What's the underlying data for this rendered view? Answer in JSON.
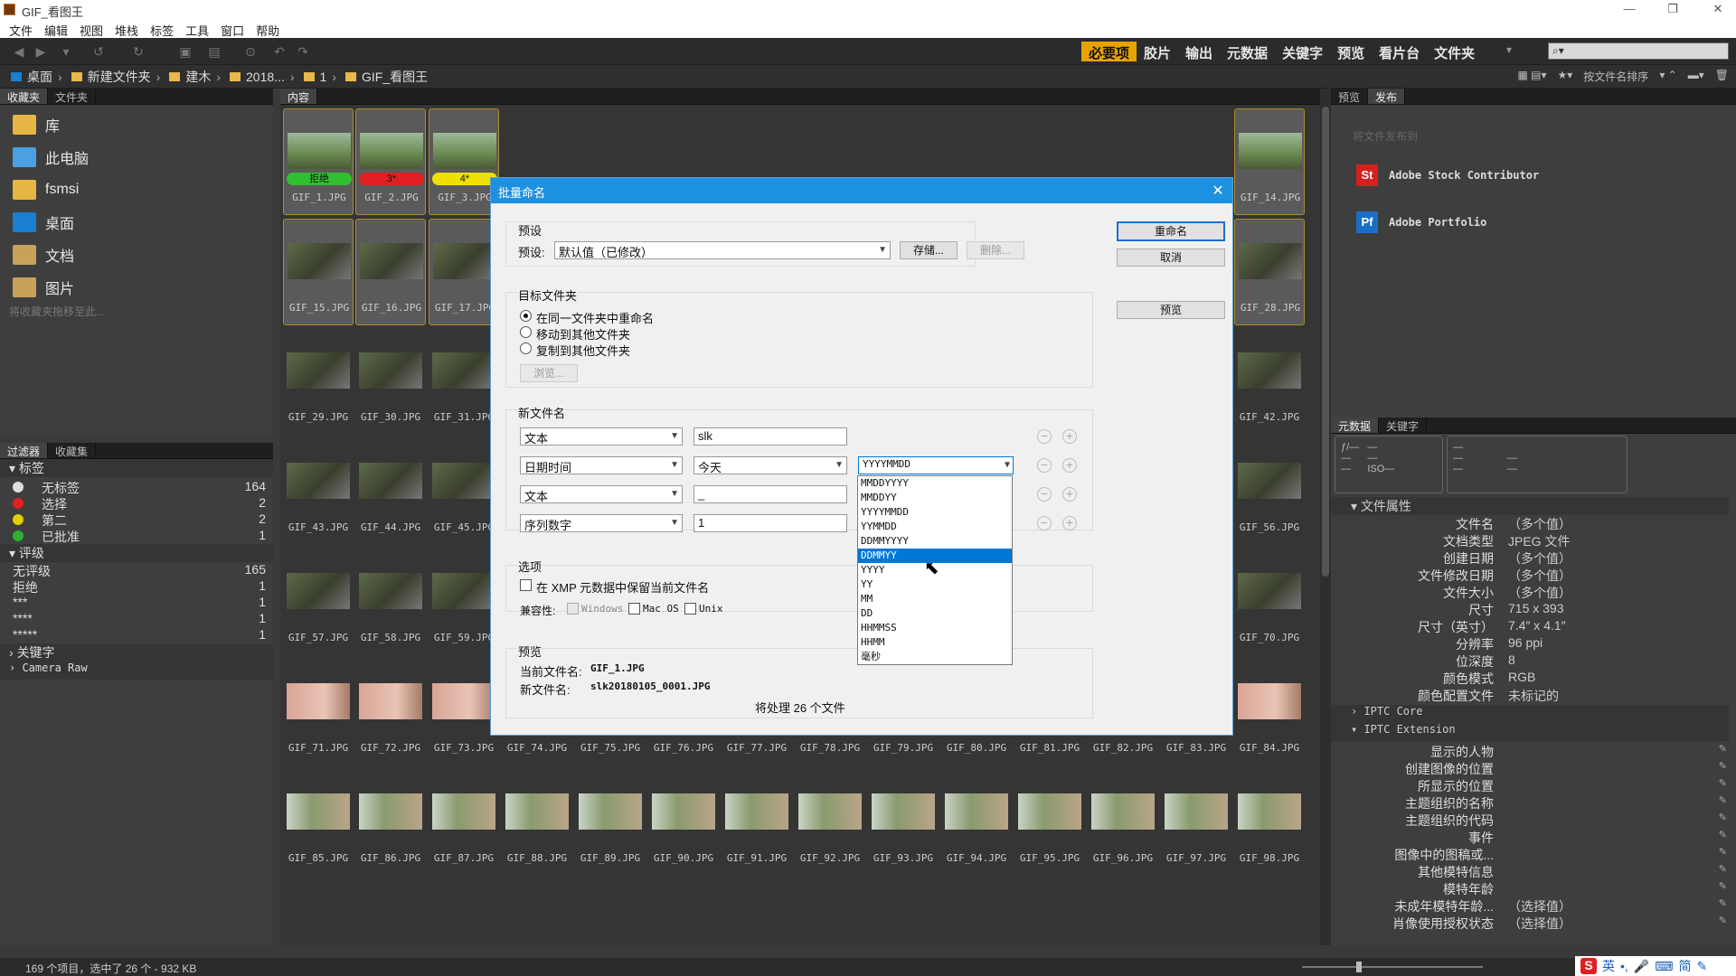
{
  "window": {
    "title": "GIF_看图王"
  },
  "menu": [
    "文件",
    "编辑",
    "视图",
    "堆栈",
    "标签",
    "工具",
    "窗口",
    "帮助"
  ],
  "workspaces": [
    "必要项",
    "胶片",
    "输出",
    "元数据",
    "关键字",
    "预览",
    "看片台",
    "文件夹"
  ],
  "path": [
    "桌面",
    "新建文件夹",
    "建木",
    "2018...",
    "1",
    "GIF_看图王"
  ],
  "sort_label": "按文件名排序",
  "fav_tabs": [
    "收藏夹",
    "文件夹"
  ],
  "fav_items": [
    "库",
    "此电脑",
    "fsmsi",
    "桌面",
    "文档",
    "图片"
  ],
  "fav_hint": "将收藏夹拖移至此...",
  "filter_tabs": [
    "过滤器",
    "收藏集"
  ],
  "filter": {
    "labels_hdr": "标签",
    "labels": [
      {
        "name": "无标签",
        "count": "164",
        "color": "#dddddd"
      },
      {
        "name": "选择",
        "count": "2",
        "color": "#e02020"
      },
      {
        "name": "第二",
        "count": "2",
        "color": "#e0d000"
      },
      {
        "name": "已批准",
        "count": "1",
        "color": "#30b030"
      }
    ],
    "rating_hdr": "评级",
    "ratings": [
      {
        "name": "无评级",
        "count": "165"
      },
      {
        "name": "拒绝",
        "count": "1"
      },
      {
        "name": "***",
        "count": "1"
      },
      {
        "name": "****",
        "count": "1"
      },
      {
        "name": "*****",
        "count": "1"
      }
    ],
    "keywords_hdr": "关键字",
    "camera_hdr": "Camera Raw"
  },
  "content_tab": "内容",
  "files": {
    "row1": [
      "GIF_1.JPG",
      "GIF_2.JPG",
      "GIF_3.JPG",
      "GIF_14.JPG"
    ],
    "row2": [
      "GIF_15.JPG",
      "GIF_16.JPG",
      "GIF_17.JPG",
      "GIF_28.JPG"
    ],
    "row3": [
      "GIF_29.JPG",
      "GIF_30.JPG",
      "GIF_31.JPG",
      "GIF_42.JPG"
    ],
    "row4": [
      "GIF_43.JPG",
      "GIF_44.JPG",
      "GIF_45.JPG",
      "GIF_56.JPG"
    ],
    "row5": [
      "GIF_57.JPG",
      "GIF_58.JPG",
      "GIF_59.JPG",
      "GIF_70.JPG"
    ],
    "row6": [
      "GIF_71.JPG",
      "GIF_72.JPG",
      "GIF_73.JPG",
      "GIF_74.JPG",
      "GIF_75.JPG",
      "GIF_76.JPG",
      "GIF_77.JPG",
      "GIF_78.JPG",
      "GIF_79.JPG",
      "GIF_80.JPG",
      "GIF_81.JPG",
      "GIF_82.JPG",
      "GIF_83.JPG",
      "GIF_84.JPG"
    ],
    "row7": [
      "GIF_85.JPG",
      "GIF_86.JPG",
      "GIF_87.JPG",
      "GIF_88.JPG",
      "GIF_89.JPG",
      "GIF_90.JPG",
      "GIF_91.JPG",
      "GIF_92.JPG",
      "GIF_93.JPG",
      "GIF_94.JPG",
      "GIF_95.JPG",
      "GIF_96.JPG",
      "GIF_97.JPG",
      "GIF_98.JPG"
    ]
  },
  "cell_labels": [
    {
      "text": "拒绝",
      "color": "#30c030"
    },
    {
      "text": "3*",
      "color": "#e02020"
    },
    {
      "text": "4*",
      "color": "#f0e000"
    }
  ],
  "right_tabs": [
    "预览",
    "发布"
  ],
  "publish_hint": "将文件发布到",
  "publish": [
    {
      "icon": "St",
      "name": "Adobe Stock Contributor",
      "color": "#d42020"
    },
    {
      "icon": "Pf",
      "name": "Adobe Portfolio",
      "color": "#1a6ec9"
    }
  ],
  "meta_tabs": [
    "元数据",
    "关键字"
  ],
  "meta_section": "文件属性",
  "meta": [
    {
      "k": "文件名",
      "v": "（多个值）"
    },
    {
      "k": "文档类型",
      "v": "JPEG 文件"
    },
    {
      "k": "创建日期",
      "v": "（多个值）"
    },
    {
      "k": "文件修改日期",
      "v": "（多个值）"
    },
    {
      "k": "文件大小",
      "v": "（多个值）"
    },
    {
      "k": "尺寸",
      "v": "715 x 393"
    },
    {
      "k": "尺寸（英寸）",
      "v": "7.4″ x 4.1″"
    },
    {
      "k": "分辨率",
      "v": "96 ppi"
    },
    {
      "k": "位深度",
      "v": "8"
    },
    {
      "k": "颜色模式",
      "v": "RGB"
    },
    {
      "k": "颜色配置文件",
      "v": "未标记的"
    }
  ],
  "iptc_core": "IPTC Core",
  "iptc_ext": "IPTC Extension",
  "iptc_rows": [
    {
      "k": "显示的人物",
      "v": ""
    },
    {
      "k": "创建图像的位置",
      "v": ""
    },
    {
      "k": "所显示的位置",
      "v": ""
    },
    {
      "k": "主题组织的名称",
      "v": ""
    },
    {
      "k": "主题组织的代码",
      "v": ""
    },
    {
      "k": "事件",
      "v": ""
    },
    {
      "k": "图像中的图稿或...",
      "v": ""
    },
    {
      "k": "其他模特信息",
      "v": ""
    },
    {
      "k": "模特年龄",
      "v": ""
    },
    {
      "k": "未成年模特年龄...",
      "v": "（选择值）"
    },
    {
      "k": "肖像使用授权状态",
      "v": "（选择值）"
    }
  ],
  "status": "169 个项目，选中了 26 个 - 932 KB",
  "dialog": {
    "title": "批量命名",
    "preset_group": "预设",
    "preset_label": "预设:",
    "preset_value": "默认值（已修改）",
    "save_btn": "存储...",
    "delete_btn": "删除...",
    "rename_btn": "重命名",
    "cancel_btn": "取消",
    "preview_btn": "预览",
    "dest_group": "目标文件夹",
    "dest_opts": [
      "在同一文件夹中重命名",
      "移动到其他文件夹",
      "复制到其他文件夹"
    ],
    "browse_btn": "浏览...",
    "newname_group": "新文件名",
    "rows": [
      {
        "type": "文本",
        "value": "slk"
      },
      {
        "type": "日期时间",
        "value": "今天",
        "fmt": "YYYYMMDD"
      },
      {
        "type": "文本",
        "value": "_"
      },
      {
        "type": "序列数字",
        "value": "1"
      }
    ],
    "date_options": [
      "MMDDYYYY",
      "MMDDYY",
      "YYYYMMDD",
      "YYMMDD",
      "DDMMYYYY",
      "DDMMYY",
      "YYYY",
      "YY",
      "MM",
      "DD",
      "HHMMSS",
      "HHMM",
      "毫秒"
    ],
    "date_highlight": "DDMMYY",
    "options_group": "选项",
    "keep_xmp": "在 XMP 元数据中保留当前文件名",
    "compat_label": "兼容性:",
    "compat": [
      "Windows",
      "Mac OS",
      "Unix"
    ],
    "preview_group": "预览",
    "current_label": "当前文件名:",
    "current_value": "GIF_1.JPG",
    "new_label": "新文件名:",
    "new_value": "slk20180105_0001.JPG",
    "process_count": "将处理 26 个文件"
  },
  "ime": [
    "英"
  ]
}
